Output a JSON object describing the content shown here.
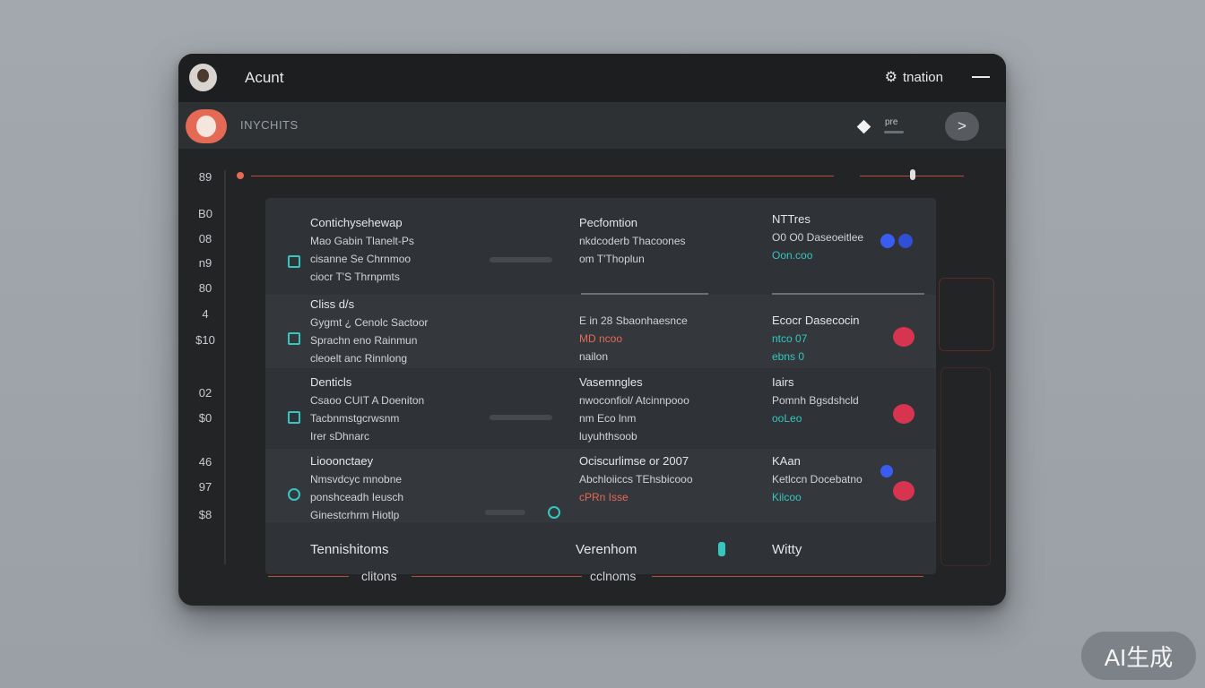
{
  "window": {
    "title": "Acunt",
    "info_label": "tnation",
    "user_name": "INYCHITS",
    "pre_label": "pre",
    "next_symbol": ">"
  },
  "axis_labels": [
    "89",
    "B0",
    "08",
    "n9",
    "80",
    "4",
    "$10",
    "02",
    "$0",
    "46",
    "97",
    "$8"
  ],
  "rows": [
    {
      "col1": [
        "Contichysehewap",
        "Mao Gabin Tlanelt-Ps",
        "cisanne Se Chrnmoo",
        "ciocr T'S Thrnpmts"
      ],
      "col2": [
        "Pecfomtion",
        "nkdcoderb Thacoones",
        "om T'Thoplun"
      ],
      "col3": [
        "NTTres",
        "O0 O0 Daseoeitlee",
        "Oon.coo"
      ]
    },
    {
      "col1": [
        "Cliss d/s",
        "Gygmt ¿ Cenolc Sactoor",
        "Sprachn eno Rainmun",
        "cleoelt anc Rinnlong"
      ],
      "col2": [
        "E in 28 Sbaonhaesnce",
        "MD ncoo",
        "nailon"
      ],
      "col3": [
        "Ecocr Dasecocin",
        "ntco 07",
        "ebns 0"
      ]
    },
    {
      "col1": [
        "Denticls",
        "Csaoo CUIT A Doeniton",
        "Tacbnmstgcrwsnm",
        "Irer sDhnarc"
      ],
      "col2": [
        "Vasemngles",
        "nwoconfiol/ Atcinnpooo",
        "nm Eco lnm",
        "luyuhthsoob"
      ],
      "col3": [
        "Iairs",
        "Pomnh Bgsdshcld",
        "ooLeo"
      ]
    },
    {
      "col1": [
        "Liooonctaey",
        "Nmsvdcyc mnobne",
        "ponshceadh Ieusch",
        "Ginestcrhrm Hiotlp"
      ],
      "col2": [
        "Ociscurlimse or 2007",
        "Abchloiiccs TEhsbicooo",
        "cPRn Isse"
      ],
      "col3": [
        "KAan",
        "Ketlccn Docebatno",
        "Kilcoo"
      ]
    }
  ],
  "footer": {
    "col1": "Tennishitoms",
    "col2": "Verenhom",
    "col3": "Witty",
    "sub1": "clitons",
    "sub2": "cclnoms"
  },
  "badge": "AI生成",
  "colors": {
    "accent_red": "#e46a55",
    "accent_teal": "#35c6c0",
    "accent_blue": "#3a5cf0",
    "accent_pink": "#d6344f",
    "window_bg": "#222426",
    "panel_bg": "#2f3236"
  }
}
